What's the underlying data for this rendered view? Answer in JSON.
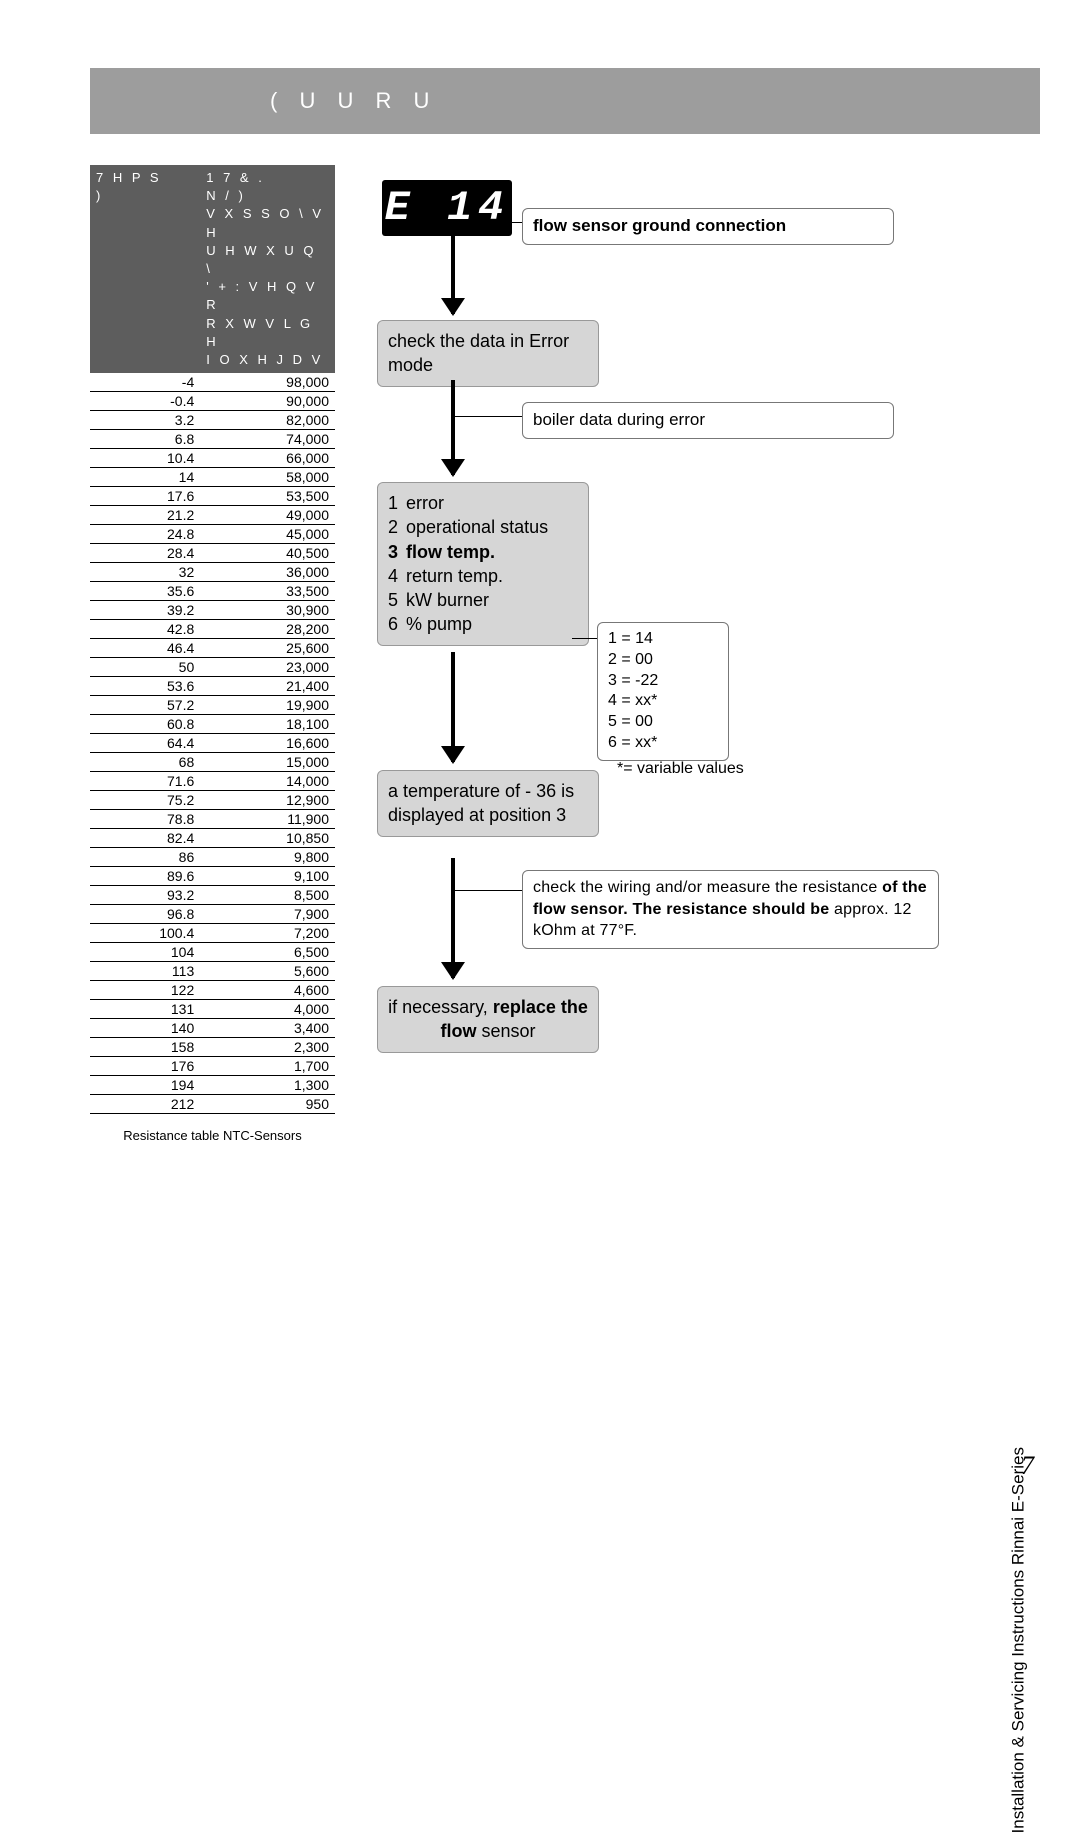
{
  "page": {
    "title": "( U U R U",
    "number": "7",
    "footer": "Installation & Servicing Instructions Rinnai E-Series"
  },
  "table": {
    "head_col1": "7 H P S\n)",
    "head_col2": "1 7 &   .\nN /   )\nV X S S O \\  V H\nU H W X U Q  \\\n' + :  V H Q V R\nR X W V L G H\nI O X H  J D V",
    "caption": "Resistance table NTC-Sensors",
    "rows": [
      {
        "t": "-4",
        "r": "98,000"
      },
      {
        "t": "-0.4",
        "r": "90,000"
      },
      {
        "t": "3.2",
        "r": "82,000"
      },
      {
        "t": "6.8",
        "r": "74,000"
      },
      {
        "t": "10.4",
        "r": "66,000"
      },
      {
        "t": "14",
        "r": "58,000"
      },
      {
        "t": "17.6",
        "r": "53,500"
      },
      {
        "t": "21.2",
        "r": "49,000"
      },
      {
        "t": "24.8",
        "r": "45,000"
      },
      {
        "t": "28.4",
        "r": "40,500"
      },
      {
        "t": "32",
        "r": "36,000"
      },
      {
        "t": "35.6",
        "r": "33,500"
      },
      {
        "t": "39.2",
        "r": "30,900"
      },
      {
        "t": "42.8",
        "r": "28,200"
      },
      {
        "t": "46.4",
        "r": "25,600"
      },
      {
        "t": "50",
        "r": "23,000"
      },
      {
        "t": "53.6",
        "r": "21,400"
      },
      {
        "t": "57.2",
        "r": "19,900"
      },
      {
        "t": "60.8",
        "r": "18,100"
      },
      {
        "t": "64.4",
        "r": "16,600"
      },
      {
        "t": "68",
        "r": "15,000"
      },
      {
        "t": "71.6",
        "r": "14,000"
      },
      {
        "t": "75.2",
        "r": "12,900"
      },
      {
        "t": "78.8",
        "r": "11,900"
      },
      {
        "t": "82.4",
        "r": "10,850"
      },
      {
        "t": "86",
        "r": "9,800"
      },
      {
        "t": "89.6",
        "r": "9,100"
      },
      {
        "t": "93.2",
        "r": "8,500"
      },
      {
        "t": "96.8",
        "r": "7,900"
      },
      {
        "t": "100.4",
        "r": "7,200"
      },
      {
        "t": "104",
        "r": "6,500"
      },
      {
        "t": "113",
        "r": "5,600"
      },
      {
        "t": "122",
        "r": "4,600"
      },
      {
        "t": "131",
        "r": "4,000"
      },
      {
        "t": "140",
        "r": "3,400"
      },
      {
        "t": "158",
        "r": "2,300"
      },
      {
        "t": "176",
        "r": "1,700"
      },
      {
        "t": "194",
        "r": "1,300"
      },
      {
        "t": "212",
        "r": "950"
      }
    ]
  },
  "flow": {
    "error_code": "E 14",
    "note_top": "flow sensor ground connection",
    "step1": "check the data in Error mode",
    "note1": "boiler data during error",
    "step2": {
      "items": [
        {
          "n": "1",
          "label": "error",
          "bold": false
        },
        {
          "n": "2",
          "label": "operational status",
          "bold": false
        },
        {
          "n": "3",
          "label": "flow temp.",
          "bold": true
        },
        {
          "n": "4",
          "label": "return temp.",
          "bold": false
        },
        {
          "n": "5",
          "label": "kW burner",
          "bold": false
        },
        {
          "n": "6",
          "label": "% pump",
          "bold": false
        }
      ]
    },
    "values_box": {
      "lines": [
        "1 = 14",
        "2 = 00",
        "3 = -22",
        "4 = xx*",
        "5 = 00",
        "6 = xx*"
      ]
    },
    "var_note": "*= variable values",
    "step3": "a temperature of - 36 is displayed at position 3",
    "note3_pre": "check the wiring and/or measure the resistance ",
    "note3_bold": "of the flow sensor. The resistance should be",
    "note3_post": " approx. 12 kOhm at 77°F.",
    "step4_pre": "if necessary, ",
    "step4_bold": "replace the flow",
    "step4_post": " sensor"
  }
}
